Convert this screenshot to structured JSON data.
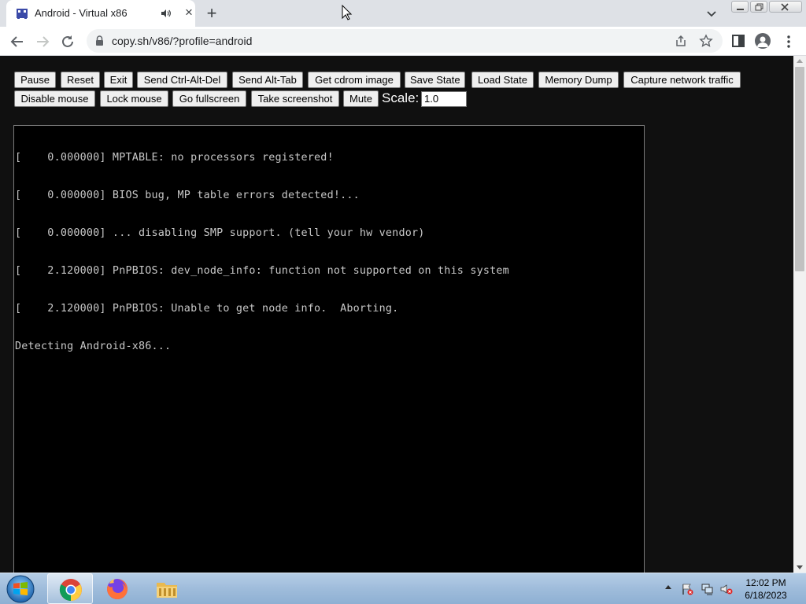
{
  "browser": {
    "tab": {
      "title": "Android - Virtual x86",
      "close_glyph": "×"
    },
    "new_tab_glyph": "+",
    "address": {
      "url": "copy.sh/v86/?profile=android"
    }
  },
  "controls": {
    "row1": [
      "Pause",
      "Reset",
      "Exit",
      "Send Ctrl-Alt-Del",
      "Send Alt-Tab",
      "Get cdrom image",
      "Save State",
      "Load State",
      "Memory Dump",
      "Capture network traffic"
    ],
    "row2": [
      "Disable mouse",
      "Lock mouse",
      "Go fullscreen",
      "Take screenshot",
      "Mute"
    ],
    "scale_label": "Scale:",
    "scale_value": "1.0"
  },
  "console": {
    "lines": [
      "[    0.000000] MPTABLE: no processors registered!",
      "[    0.000000] BIOS bug, MP table errors detected!...",
      "[    0.000000] ... disabling SMP support. (tell your hw vendor)",
      "[    2.120000] PnPBIOS: dev_node_info: function not supported on this system",
      "[    2.120000] PnPBIOS: Unable to get node info.  Aborting.",
      "Detecting Android-x86..."
    ]
  },
  "taskbar": {
    "apps": [
      "chrome-icon",
      "firefox-icon",
      "file-explorer-icon"
    ],
    "clock": {
      "time": "12:02 PM",
      "date": "6/18/2023"
    }
  },
  "colors": {
    "page_background": "#101010",
    "console_text": "#c8c8c8",
    "tab_strip": "#dee1e6"
  }
}
